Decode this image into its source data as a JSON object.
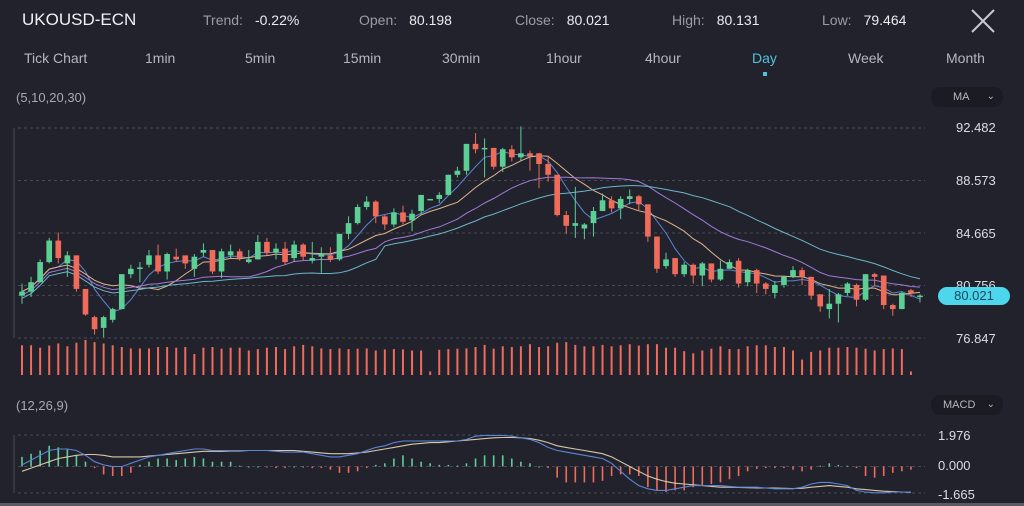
{
  "header": {
    "symbol": "UKOUSD-ECN",
    "stats": [
      {
        "key": "Trend:",
        "value": "-0.22%"
      },
      {
        "key": "Open:",
        "value": "80.198"
      },
      {
        "key": "Close:",
        "value": "80.021"
      },
      {
        "key": "High:",
        "value": "80.131"
      },
      {
        "key": "Low:",
        "value": "79.464"
      }
    ],
    "close_icon": "close-x-icon"
  },
  "timeframes": {
    "items": [
      "Tick Chart",
      "1min",
      "5min",
      "15min",
      "30min",
      "1hour",
      "4hour",
      "Day",
      "Week",
      "Month"
    ],
    "active": "Day"
  },
  "main_panel": {
    "params_label": "(5,10,20,30)",
    "indicator_select": "MA",
    "current_price": "80.021"
  },
  "macd_panel": {
    "params_label": "(12,26,9)",
    "indicator_select": "MACD"
  },
  "colors": {
    "background": "#22222d",
    "up": "#5ccf94",
    "down": "#ef6b5a",
    "ma5": "#5a86d6",
    "ma10": "#e0b48a",
    "ma20": "#a07ad8",
    "ma30": "#6bb6c8",
    "accent": "#4fc3d9",
    "grid": "#4a4a56",
    "macd_dif": "#5a86d6",
    "macd_dea": "#d8c8a8"
  },
  "chart_data": [
    {
      "type": "candlestick",
      "title": "UKOUSD-ECN Day",
      "indicator": "MA (5,10,20,30)",
      "y_ticks": [
        "92.482",
        "88.573",
        "84.665",
        "80.756",
        "76.847"
      ],
      "ylim": [
        76.847,
        92.482
      ],
      "grid": true,
      "last_price": 80.021,
      "ohlc": [
        [
          80.0,
          80.3,
          79.4,
          80.9
        ],
        [
          80.3,
          81.0,
          79.9,
          81.4
        ],
        [
          81.0,
          82.5,
          81.0,
          82.7
        ],
        [
          82.5,
          84.1,
          82.4,
          84.3
        ],
        [
          84.1,
          82.8,
          82.4,
          84.7
        ],
        [
          82.4,
          83.0,
          81.4,
          83.3
        ],
        [
          83.0,
          80.5,
          80.3,
          83.0
        ],
        [
          80.5,
          78.6,
          78.5,
          80.5
        ],
        [
          78.4,
          77.5,
          77.1,
          78.5
        ],
        [
          77.6,
          78.4,
          76.9,
          78.5
        ],
        [
          78.2,
          79.0,
          78.0,
          79.1
        ],
        [
          79.0,
          81.6,
          79.0,
          81.6
        ],
        [
          81.6,
          82.0,
          81.3,
          82.3
        ],
        [
          82.0,
          82.1,
          81.0,
          82.5
        ],
        [
          82.3,
          83.0,
          82.1,
          83.4
        ],
        [
          83.0,
          81.8,
          81.6,
          83.8
        ],
        [
          81.8,
          83.1,
          81.2,
          83.2
        ],
        [
          82.9,
          82.7,
          82.5,
          83.5
        ],
        [
          83.0,
          82.4,
          82.0,
          82.8
        ],
        [
          82.0,
          82.9,
          81.4,
          83.1
        ],
        [
          83.2,
          83.4,
          82.9,
          83.9
        ],
        [
          83.4,
          81.8,
          81.6,
          83.4
        ],
        [
          81.8,
          83.3,
          81.3,
          83.5
        ],
        [
          83.0,
          83.3,
          82.8,
          83.8
        ],
        [
          83.3,
          82.8,
          82.6,
          83.5
        ],
        [
          82.5,
          82.7,
          82.4,
          83.4
        ],
        [
          82.7,
          84.0,
          82.7,
          84.5
        ],
        [
          84.0,
          83.2,
          83.0,
          84.3
        ],
        [
          83.2,
          83.5,
          82.7,
          83.9
        ],
        [
          83.5,
          82.5,
          82.3,
          84.0
        ],
        [
          82.8,
          83.8,
          82.5,
          84.1
        ],
        [
          83.8,
          82.9,
          82.6,
          83.9
        ],
        [
          82.6,
          82.8,
          82.4,
          84.0
        ],
        [
          82.9,
          83.1,
          81.7,
          83.6
        ],
        [
          83.0,
          82.7,
          82.5,
          83.6
        ],
        [
          82.7,
          84.6,
          82.6,
          84.6
        ],
        [
          84.6,
          85.4,
          84.2,
          85.9
        ],
        [
          85.4,
          86.6,
          85.3,
          86.8
        ],
        [
          86.6,
          87.0,
          86.4,
          87.4
        ],
        [
          87.0,
          85.9,
          85.4,
          87.1
        ],
        [
          85.9,
          85.3,
          84.9,
          86.0
        ],
        [
          85.3,
          86.2,
          85.1,
          86.5
        ],
        [
          86.2,
          85.5,
          85.3,
          86.7
        ],
        [
          85.6,
          86.1,
          84.8,
          86.4
        ],
        [
          86.3,
          87.5,
          86.0,
          87.5
        ],
        [
          87.2,
          87.2,
          87.1,
          87.2
        ],
        [
          87.2,
          87.5,
          86.9,
          87.7
        ],
        [
          87.5,
          89.0,
          87.5,
          89.0
        ],
        [
          89.0,
          89.3,
          88.8,
          89.6
        ],
        [
          89.3,
          91.3,
          89.0,
          91.3
        ],
        [
          91.3,
          90.9,
          90.6,
          92.1
        ],
        [
          90.9,
          91.0,
          88.8,
          91.7
        ],
        [
          91.0,
          89.6,
          89.4,
          91.0
        ],
        [
          89.6,
          90.9,
          89.2,
          91.0
        ],
        [
          90.9,
          90.3,
          90.0,
          91.2
        ],
        [
          90.3,
          90.6,
          90.0,
          92.6
        ],
        [
          90.6,
          90.4,
          89.3,
          90.8
        ],
        [
          90.6,
          89.8,
          88.0,
          90.6
        ],
        [
          89.8,
          89.0,
          88.5,
          90.3
        ],
        [
          89.0,
          86.0,
          85.9,
          89.0
        ],
        [
          86.0,
          85.2,
          84.6,
          86.3
        ],
        [
          85.2,
          85.4,
          84.3,
          88.1
        ],
        [
          85.0,
          85.3,
          84.2,
          85.4
        ],
        [
          85.4,
          86.3,
          84.4,
          86.6
        ],
        [
          86.3,
          87.1,
          86.3,
          87.6
        ],
        [
          87.1,
          86.5,
          86.2,
          87.4
        ],
        [
          86.5,
          87.2,
          85.7,
          87.4
        ],
        [
          87.2,
          87.4,
          86.8,
          87.9
        ],
        [
          87.4,
          86.8,
          86.3,
          87.5
        ],
        [
          86.8,
          84.4,
          84.0,
          86.8
        ],
        [
          84.4,
          82.0,
          81.7,
          84.4
        ],
        [
          82.2,
          82.7,
          82.0,
          83.2
        ],
        [
          82.8,
          81.6,
          81.4,
          82.8
        ],
        [
          81.6,
          82.3,
          81.4,
          82.5
        ],
        [
          82.3,
          81.5,
          80.9,
          82.4
        ],
        [
          81.5,
          82.4,
          80.7,
          82.5
        ],
        [
          82.4,
          81.2,
          81.0,
          82.4
        ],
        [
          81.2,
          82.0,
          81.1,
          82.6
        ],
        [
          82.0,
          82.5,
          82.0,
          82.7
        ],
        [
          82.6,
          80.9,
          80.6,
          82.8
        ],
        [
          81.0,
          81.9,
          80.7,
          82.0
        ],
        [
          81.9,
          80.9,
          80.2,
          82.0
        ],
        [
          80.9,
          80.5,
          80.1,
          81.0
        ],
        [
          80.2,
          80.8,
          79.8,
          81.1
        ],
        [
          80.8,
          81.4,
          80.6,
          81.5
        ],
        [
          81.4,
          81.9,
          81.3,
          82.2
        ],
        [
          81.9,
          81.4,
          80.8,
          82.1
        ],
        [
          81.4,
          80.0,
          79.7,
          81.4
        ],
        [
          80.1,
          79.2,
          78.8,
          80.0
        ],
        [
          79.0,
          79.4,
          78.3,
          80.5
        ],
        [
          79.4,
          80.1,
          78.0,
          80.2
        ],
        [
          80.2,
          80.9,
          80.0,
          81.0
        ],
        [
          80.8,
          79.7,
          79.2,
          80.9
        ],
        [
          79.7,
          81.6,
          79.6,
          81.6
        ],
        [
          81.6,
          81.4,
          80.7,
          81.7
        ],
        [
          81.5,
          79.3,
          79.0,
          81.5
        ],
        [
          79.3,
          79.0,
          78.5,
          79.4
        ],
        [
          79.0,
          80.2,
          79.0,
          80.3
        ],
        [
          80.4,
          80.2,
          79.9,
          80.5
        ],
        [
          79.9,
          80.0,
          79.5,
          80.1
        ]
      ],
      "ohlc_order": [
        "open",
        "close",
        "low",
        "high"
      ],
      "ma_periods": [
        5,
        10,
        20,
        30
      ]
    },
    {
      "type": "bar",
      "title": "Volume",
      "values_relative": [
        0.85,
        0.85,
        0.78,
        0.84,
        0.9,
        0.82,
        0.92,
        1.0,
        0.94,
        0.9,
        0.85,
        0.8,
        0.76,
        0.76,
        0.76,
        0.8,
        0.8,
        0.78,
        0.8,
        0.6,
        0.78,
        0.8,
        0.75,
        0.78,
        0.78,
        0.7,
        0.74,
        0.78,
        0.8,
        0.74,
        0.82,
        0.86,
        0.82,
        0.76,
        0.74,
        0.76,
        0.74,
        0.75,
        0.76,
        0.7,
        0.73,
        0.74,
        0.73,
        0.7,
        0.7,
        0.1,
        0.72,
        0.74,
        0.75,
        0.76,
        0.8,
        0.86,
        0.75,
        0.82,
        0.8,
        0.82,
        0.88,
        0.8,
        0.82,
        0.92,
        0.94,
        0.86,
        0.82,
        0.82,
        0.86,
        0.82,
        0.85,
        0.88,
        0.84,
        0.88,
        0.88,
        0.78,
        0.78,
        0.68,
        0.62,
        0.7,
        0.75,
        0.82,
        0.74,
        0.74,
        0.82,
        0.85,
        0.85,
        0.8,
        0.8,
        0.7,
        0.44,
        0.66,
        0.7,
        0.78,
        0.78,
        0.8,
        0.78,
        0.75,
        0.7,
        0.74,
        0.76,
        0.74,
        0.1
      ]
    },
    {
      "type": "line",
      "title": "MACD (12,26,9)",
      "y_ticks": [
        "1.976",
        "0.000",
        "-1.665"
      ],
      "ylim": [
        -1.665,
        1.976
      ],
      "hist": [
        0.6,
        0.8,
        1.0,
        1.3,
        1.2,
        1.1,
        0.7,
        0.3,
        -0.1,
        -0.5,
        -0.6,
        -0.6,
        -0.4,
        0.1,
        0.3,
        0.5,
        0.5,
        0.4,
        0.5,
        0.6,
        0.5,
        0.3,
        0.3,
        0.3,
        0.05,
        0.0,
        0.0,
        -0.05,
        -0.1,
        -0.1,
        0.0,
        0.0,
        -0.1,
        -0.1,
        -0.2,
        -0.4,
        -0.4,
        -0.3,
        -0.1,
        0.1,
        0.2,
        0.5,
        0.7,
        0.5,
        0.3,
        0.2,
        0.1,
        0.1,
        0.05,
        0.2,
        0.5,
        0.7,
        0.7,
        0.7,
        0.5,
        0.3,
        0.2,
        0.0,
        -0.1,
        -0.7,
        -1.0,
        -1.0,
        -1.0,
        -1.0,
        -0.9,
        -0.6,
        -0.5,
        -0.5,
        -0.6,
        -1.3,
        -1.5,
        -1.6,
        -1.5,
        -1.5,
        -1.3,
        -1.2,
        -1.1,
        -1.0,
        -0.8,
        -0.6,
        -0.3,
        -0.15,
        -0.1,
        -0.1,
        -0.1,
        -0.2,
        -0.3,
        -0.2,
        0.05,
        0.2,
        0.1,
        0.05,
        -0.1,
        -0.6,
        -0.7,
        -0.6,
        -0.4,
        -0.3,
        -0.2
      ],
      "dif": [
        0.1,
        0.4,
        0.7,
        1.0,
        1.1,
        1.1,
        1.0,
        0.7,
        0.3,
        0.1,
        0.0,
        0.0,
        0.2,
        0.4,
        0.6,
        0.7,
        0.8,
        0.9,
        1.0,
        1.1,
        1.1,
        1.0,
        1.0,
        1.0,
        1.0,
        1.0,
        1.0,
        1.0,
        0.95,
        0.9,
        0.9,
        0.9,
        0.8,
        0.7,
        0.6,
        0.6,
        0.7,
        0.8,
        1.0,
        1.2,
        1.3,
        1.5,
        1.6,
        1.6,
        1.6,
        1.6,
        1.6,
        1.6,
        1.6,
        1.7,
        1.9,
        1.95,
        1.95,
        1.95,
        1.9,
        1.8,
        1.7,
        1.5,
        1.2,
        1.0,
        0.9,
        0.8,
        0.7,
        0.6,
        0.5,
        0.2,
        -0.3,
        -0.8,
        -1.2,
        -1.4,
        -1.5,
        -1.5,
        -1.4,
        -1.3,
        -1.2,
        -1.2,
        -1.2,
        -1.2,
        -1.25,
        -1.3,
        -1.3,
        -1.3,
        -1.35,
        -1.4,
        -1.4,
        -1.4,
        -1.3,
        -1.1,
        -1.0,
        -1.0,
        -1.1,
        -1.2,
        -1.5,
        -1.6,
        -1.65,
        -1.65,
        -1.6,
        -1.6,
        -1.6
      ],
      "dea": [
        -0.3,
        -0.1,
        0.1,
        0.3,
        0.5,
        0.6,
        0.7,
        0.75,
        0.75,
        0.7,
        0.6,
        0.6,
        0.6,
        0.6,
        0.65,
        0.7,
        0.75,
        0.8,
        0.85,
        0.9,
        0.95,
        0.95,
        0.95,
        0.97,
        0.98,
        1.0,
        1.0,
        1.0,
        1.0,
        1.0,
        1.0,
        0.95,
        0.9,
        0.85,
        0.8,
        0.8,
        0.8,
        0.85,
        0.9,
        1.0,
        1.1,
        1.2,
        1.3,
        1.4,
        1.45,
        1.5,
        1.5,
        1.55,
        1.6,
        1.65,
        1.7,
        1.75,
        1.8,
        1.82,
        1.82,
        1.8,
        1.75,
        1.65,
        1.5,
        1.3,
        1.2,
        1.1,
        1.0,
        0.9,
        0.8,
        0.6,
        0.3,
        0.0,
        -0.3,
        -0.6,
        -0.8,
        -0.95,
        -1.05,
        -1.1,
        -1.15,
        -1.2,
        -1.25,
        -1.3,
        -1.3,
        -1.32,
        -1.33,
        -1.35,
        -1.35,
        -1.36,
        -1.37,
        -1.38,
        -1.37,
        -1.3,
        -1.25,
        -1.2,
        -1.25,
        -1.3,
        -1.4,
        -1.45,
        -1.5,
        -1.55,
        -1.58,
        -1.6,
        -1.62
      ]
    }
  ]
}
